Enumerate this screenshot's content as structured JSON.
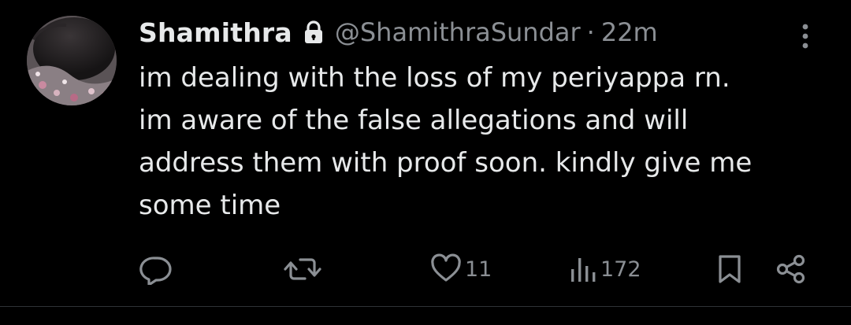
{
  "tweet": {
    "author_name": "Shamithra",
    "handle": "@ShamithraSundar",
    "separator": "·",
    "time": "22m",
    "text": "im dealing with the loss of my periyappa rn.\nim aware of the false allegations and will\naddress them with proof soon. kindly give me\nsome time",
    "protected_icon": "lock-icon",
    "more_icon": "more-vertical-icon"
  },
  "actions": {
    "reply": {
      "icon": "reply-icon",
      "count": ""
    },
    "repost": {
      "icon": "repost-icon",
      "count": ""
    },
    "like": {
      "icon": "heart-icon",
      "count": "11"
    },
    "views": {
      "icon": "views-icon",
      "count": "172"
    },
    "bookmark": {
      "icon": "bookmark-icon"
    },
    "share": {
      "icon": "share-icon"
    }
  },
  "colors": {
    "background": "#000000",
    "text_primary": "#e7e9ea",
    "text_secondary": "#8b8f94",
    "divider": "#2f3336"
  }
}
